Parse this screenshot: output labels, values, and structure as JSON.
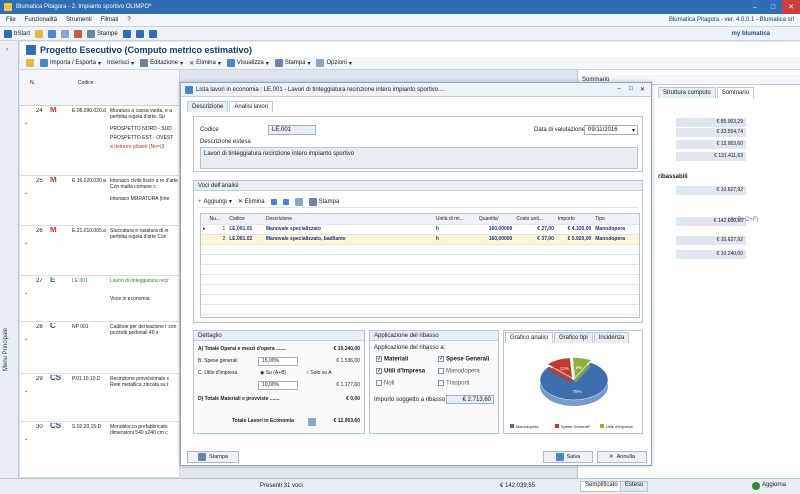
{
  "window": {
    "title": "Blumatica Pitagora - 2. Impianto sportivo OLIMPO*"
  },
  "menu": {
    "items": [
      "File",
      "Funzionalità",
      "Strumenti",
      "Filmati",
      "?"
    ],
    "brand": "Blumatica Pitagora - ver. 4.0.0.1 - Blumatica srl"
  },
  "toolbar": {
    "start": "bStart",
    "stampe": "Stampe",
    "logo": "my blumatica"
  },
  "sidebar": {
    "label": "Menu Principale"
  },
  "project": {
    "title": "Progetto Esecutivo (Computo metrico estimativo)"
  },
  "ptool": {
    "items": [
      "Importa / Esporta",
      "Inserisci",
      "Editazione",
      "Elimina",
      "Visualizza",
      "Stampa",
      "Opzioni"
    ]
  },
  "grid": {
    "headers": {
      "n": "N.",
      "codice": "Codice",
      "num": "Num",
      "altezza": "Altezza"
    },
    "rows": [
      {
        "n": "24",
        "type": "M",
        "code": "E.08.090.020.d",
        "desc": "Muratura a cassa vuota, e a perfetta regola d'arte. Sp",
        "extra": [
          "PROSPETTO NORD - SUD",
          "PROSPETTO EST - OVEST",
          "a detrarre pilastri (No=(3"
        ]
      },
      {
        "n": "25",
        "type": "M",
        "code": "E.16.020.030.a",
        "desc": "Intonaco civile liscio a re d'arte Con malta comune c",
        "extra": [
          "Intonaco MURATURA (inte"
        ]
      },
      {
        "n": "26",
        "type": "M",
        "code": "E.21.010.005.a",
        "desc": "Stuccatura e rasatura di in perfetta regola d'arte Con",
        "extra": []
      },
      {
        "n": "27",
        "type": "E",
        "code": "LE.001",
        "desc": "Lavori di tinteggiatura recir",
        "extra": [
          "Voce in economia"
        ]
      },
      {
        "n": "28",
        "type": "C",
        "code": "NP 001",
        "desc": "Caditoie per derivazione r con pozzetti pedonali 40 x",
        "extra": []
      },
      {
        "n": "29",
        "type": "CS",
        "code": "P.01.10.10.D",
        "desc": "Recinzione provvisionale c Rete metallica zincata su t",
        "extra": []
      },
      {
        "n": "30",
        "type": "CS",
        "code": "S.02.20.15.D",
        "desc": "Monoblocco prefabbricato dimensioni 540 x240 cm c",
        "extra": []
      }
    ]
  },
  "dialog": {
    "title": "Lista lavori in economia : LE.001 - Lavori di tinteggiatura recinzione intero impianto sportivo....",
    "tabs": [
      "Descrizione",
      "Analisi lavori"
    ],
    "codice_label": "Codice",
    "codice": "LE.001",
    "data_label": "Data di valutazione",
    "data": "09/11/2016",
    "desc_label": "Descrizione estesa",
    "desc": "Lavori di tinteggiatura recinzione intero impianto sportivo",
    "voci_label": "Voci dell'analisi",
    "voci_tool": {
      "aggiungi": "Aggiungi",
      "elimina": "Elimina",
      "stampa": "Stampa"
    },
    "table": {
      "headers": [
        "Nu...",
        "Codice",
        "Descrizione",
        "Unità di mi...",
        "Quantita'",
        "Costo unit...",
        "Importo",
        "Tipo"
      ],
      "rows": [
        {
          "n": "1",
          "code": "LE.001.01",
          "desc": "Manovale specializzato",
          "um": "h",
          "q": "160,00000",
          "cu": "€ 27,00",
          "imp": "€ 4.320,00",
          "tipo": "Manodopera"
        },
        {
          "n": "2",
          "code": "LE.001.02",
          "desc": "Manovale specializzato, badilante",
          "um": "h",
          "q": "160,00000",
          "cu": "€ 37,00",
          "imp": "€ 5.920,00",
          "tipo": "Manodopera"
        }
      ]
    },
    "dettaglio": {
      "head": "Dettaglio",
      "a_label": "A) Totale Operai e mezzi d'opera .......",
      "a_val": "€ 10.240,00",
      "b_label": "B. Spese generali",
      "b_pct": "15,00%",
      "b_val": "€ 1.536,00",
      "c_label": "C. Utile d'impresa",
      "c_opt1": "Su (A+B)",
      "c_opt2": "Solo su A",
      "c_pct": "10,00%",
      "c_val": "€ 1.177,60",
      "d_label": "D) Totale Materiali e provviste .......",
      "d_val": "€ 0,00",
      "tot_label": "Totale Lavori in Economia",
      "tot_val": "€ 12.953,60"
    },
    "ribasso": {
      "head": "Applicazione del ribasso",
      "sub": "Applicazione del ribasso a:",
      "items": [
        {
          "label": "Materiali",
          "checked": true
        },
        {
          "label": "Spese Generali",
          "checked": true
        },
        {
          "label": "Utili d'Impresa",
          "checked": true
        },
        {
          "label": "Manodopera",
          "checked": false
        },
        {
          "label": "Noli",
          "checked": false
        },
        {
          "label": "Trasporti",
          "checked": false
        }
      ],
      "importo_label": "Importo soggetto a ribasso",
      "importo_val": "€ 2.713,60"
    },
    "grafico": {
      "tabs": [
        "Grafico analisi",
        "Grafico tipi",
        "Incidenza"
      ],
      "slices": [
        {
          "label": "Manodopera",
          "value": 79,
          "pct": "79%",
          "color": "#3d6fb0"
        },
        {
          "label": "Spese Generali*",
          "value": 12,
          "pct": "12%",
          "color": "#c0392b"
        },
        {
          "label": "Utile d'Impresa",
          "value": 9,
          "pct": "9%",
          "color": "#8fae3a"
        }
      ]
    },
    "buttons": {
      "stampa": "Stampa",
      "salva": "Salva",
      "annulla": "Annulla"
    }
  },
  "rightpanel": {
    "tabs": [
      "Sommario",
      "Struttura computo",
      "Sommario"
    ],
    "values": [
      "€ 85.903,29",
      "€ 32.554,74",
      "€ 12.953,60",
      "€ 131.411,63",
      "ribassabili",
      "€ 10.627,92",
      "€ 142.039,55",
      "(A+B+C+F)",
      "€ 10.627,92",
      "€ 10.240,00"
    ]
  },
  "status": {
    "voci": "Presenti 31 voci",
    "total": "€ 142.039,55",
    "tab1": "Semplificato",
    "tab2": "Esteso",
    "aggiorna": "Aggiorna"
  }
}
